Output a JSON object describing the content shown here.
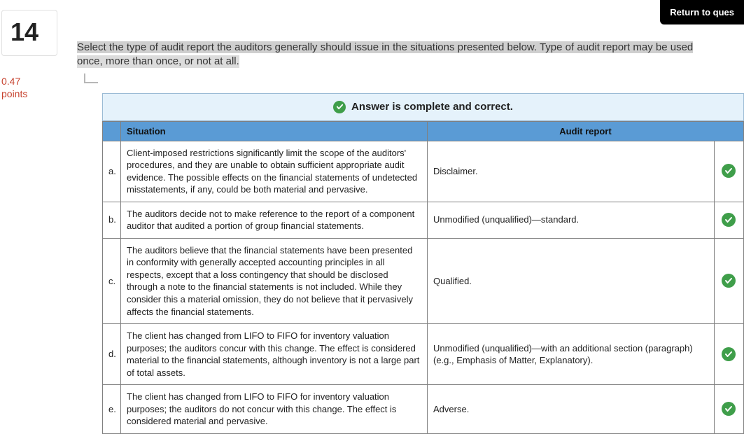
{
  "header": {
    "return_label": "Return to ques"
  },
  "question": {
    "number": "14",
    "points_value": "0.47",
    "points_label": "points",
    "prompt_line1": "Select the type of audit report the auditors generally should issue in the situations presented below. Type of audit report may be used",
    "prompt_line2": "once, more than once, or not at all."
  },
  "banner": {
    "text": "Answer is complete and correct."
  },
  "table": {
    "headers": {
      "situation": "Situation",
      "report": "Audit report"
    },
    "rows": [
      {
        "key": "a.",
        "situation": "Client-imposed restrictions significantly limit the scope of the auditors' procedures, and they are unable to obtain sufficient appropriate audit evidence. The possible effects on the financial statements of undetected misstatements, if any, could be both material and pervasive.",
        "report": "Disclaimer."
      },
      {
        "key": "b.",
        "situation": "The auditors decide not to make reference to the report of a component auditor that audited a portion of group financial statements.",
        "report": "Unmodified (unqualified)—standard."
      },
      {
        "key": "c.",
        "situation": "The auditors believe that the financial statements have been presented in conformity with generally accepted accounting principles in all respects, except that a loss contingency that should be disclosed through a note to the financial statements is not included. While they consider this a material omission, they do not believe that it pervasively affects the financial statements.",
        "report": "Qualified."
      },
      {
        "key": "d.",
        "situation": "The client has changed from LIFO to FIFO for inventory valuation purposes; the auditors concur with this change. The effect is considered material to the financial statements, although inventory is not a large part of total assets.",
        "report": "Unmodified (unqualified)—with an additional section (paragraph) (e.g., Emphasis of Matter, Explanatory)."
      },
      {
        "key": "e.",
        "situation": "The client has changed from LIFO to FIFO for inventory valuation purposes; the auditors do not concur with this change. The effect is considered material and pervasive.",
        "report": "Adverse."
      }
    ]
  }
}
